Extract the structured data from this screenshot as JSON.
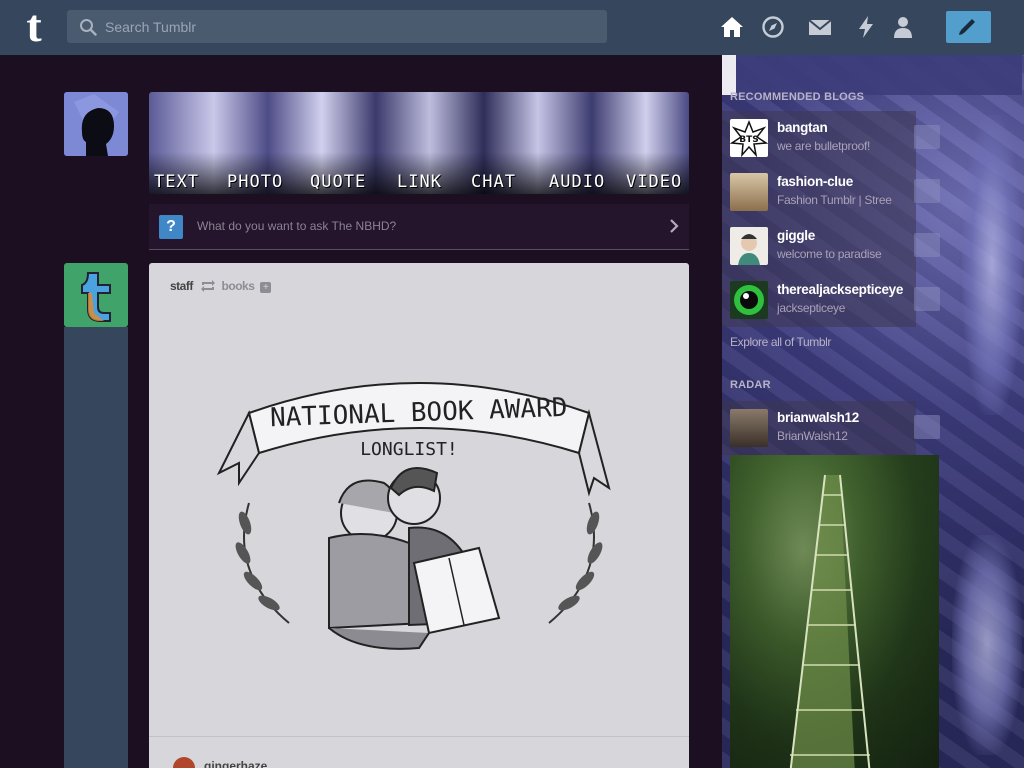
{
  "header": {
    "logo": "t",
    "search_placeholder": "Search Tumblr",
    "nav_icons": [
      "home-icon",
      "explore-icon",
      "inbox-icon",
      "activity-icon",
      "account-icon",
      "compose-icon"
    ]
  },
  "post_types": [
    "TEXT",
    "PHOTO",
    "QUOTE",
    "LINK",
    "CHAT",
    "AUDIO",
    "VIDEO"
  ],
  "ask_bar": {
    "prompt": "What do you want to ask The NBHD?"
  },
  "post": {
    "author": "staff",
    "source": "books",
    "illustration": {
      "banner_line1": "NATIONAL BOOK AWARD",
      "banner_line2": "LONGLIST!"
    },
    "next_author": "gingerhaze"
  },
  "sidebar": {
    "recommended_title": "RECOMMENDED BLOGS",
    "recommended": [
      {
        "name": "bangtan",
        "desc": "we are bulletproof!",
        "color": "#ffffff"
      },
      {
        "name": "fashion-clue",
        "desc": "Fashion Tumblr | Stree",
        "color": "#c9a77a"
      },
      {
        "name": "giggle",
        "desc": "welcome to paradise",
        "color": "#e8e2dc"
      },
      {
        "name": "therealjacksepticeye",
        "desc": "jacksepticeye",
        "color": "#37c24a"
      }
    ],
    "explore_link": "Explore all of Tumblr",
    "radar_title": "RADAR",
    "radar_blog": {
      "name": "brianwalsh12",
      "desc": "BrianWalsh12"
    }
  }
}
